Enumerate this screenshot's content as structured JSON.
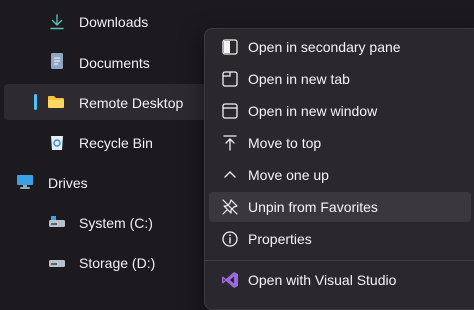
{
  "sidebar": {
    "items": [
      {
        "label": "Downloads",
        "icon": "download-icon"
      },
      {
        "label": "Documents",
        "icon": "document-icon"
      },
      {
        "label": "Remote Desktop",
        "icon": "folder-icon"
      },
      {
        "label": "Recycle Bin",
        "icon": "recycle-bin-icon"
      },
      {
        "label": "Drives",
        "icon": "monitor-icon"
      },
      {
        "label": "System (C:)",
        "icon": "drive-icon"
      },
      {
        "label": "Storage (D:)",
        "icon": "drive-icon"
      }
    ]
  },
  "context_menu": {
    "items": [
      {
        "label": "Open in secondary pane",
        "icon": "split-pane-icon"
      },
      {
        "label": "Open in new tab",
        "icon": "new-tab-icon"
      },
      {
        "label": "Open in new window",
        "icon": "new-window-icon"
      },
      {
        "label": "Move to top",
        "icon": "move-to-top-icon"
      },
      {
        "label": "Move one up",
        "icon": "chevron-up-icon"
      },
      {
        "label": "Unpin from Favorites",
        "icon": "unpin-icon"
      },
      {
        "label": "Properties",
        "icon": "info-icon"
      },
      {
        "label": "Open with Visual Studio",
        "icon": "visual-studio-icon"
      }
    ]
  },
  "colors": {
    "accent": "#4cc2ff",
    "background": "#1c1a1e",
    "menu_background": "#2a282c",
    "visual_studio": "#9b6bdc"
  }
}
